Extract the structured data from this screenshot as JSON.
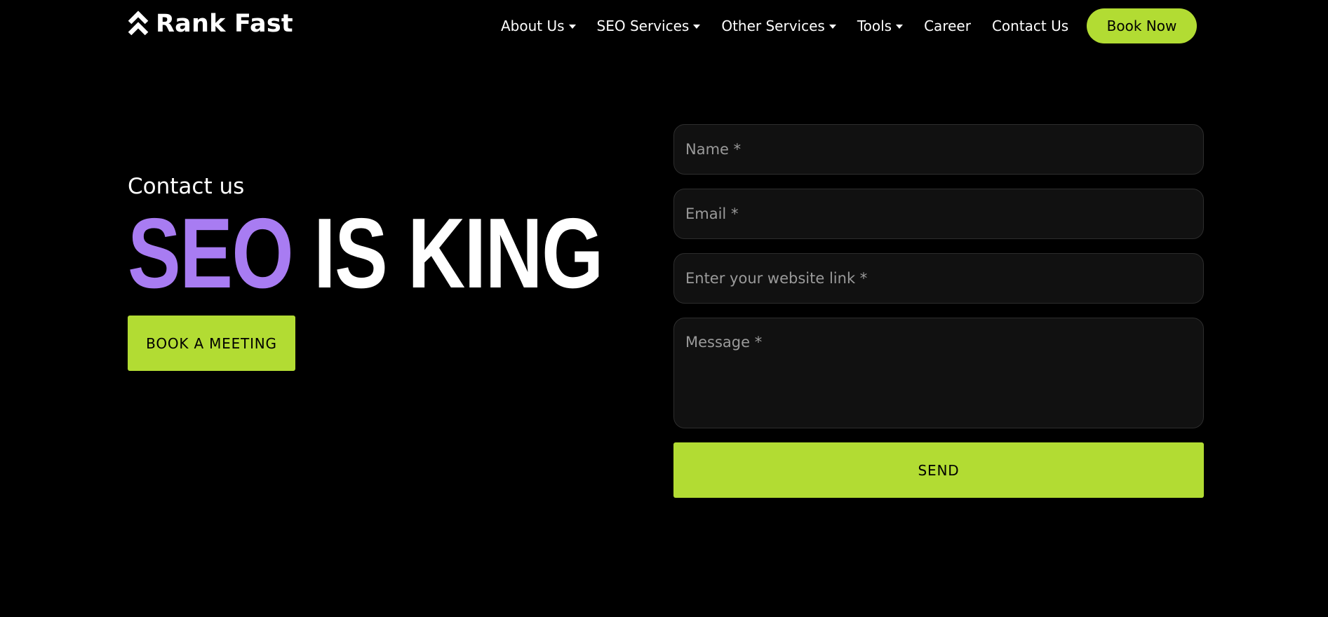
{
  "header": {
    "logo": {
      "icon": "double-chevron-up-icon",
      "text": "Rank Fast"
    },
    "nav": [
      {
        "label": "About Us",
        "dropdown": true
      },
      {
        "label": "SEO Services",
        "dropdown": true
      },
      {
        "label": "Other Services",
        "dropdown": true
      },
      {
        "label": "Tools",
        "dropdown": true
      },
      {
        "label": "Career",
        "dropdown": false
      },
      {
        "label": "Contact Us",
        "dropdown": false
      }
    ],
    "cta": "Book Now"
  },
  "hero": {
    "eyebrow": "Contact us",
    "headline_accent": "SEO",
    "headline_rest": "IS KING",
    "button": "BOOK A MEETING"
  },
  "form": {
    "name_placeholder": "Name *",
    "email_placeholder": "Email *",
    "website_placeholder": "Enter your website link *",
    "message_placeholder": "Message *",
    "submit": "SEND"
  },
  "colors": {
    "background": "#000000",
    "accent_green": "#b2dc33",
    "accent_purple": "#a87cf2",
    "field_bg": "#111111",
    "field_border": "#2d2d2d"
  }
}
